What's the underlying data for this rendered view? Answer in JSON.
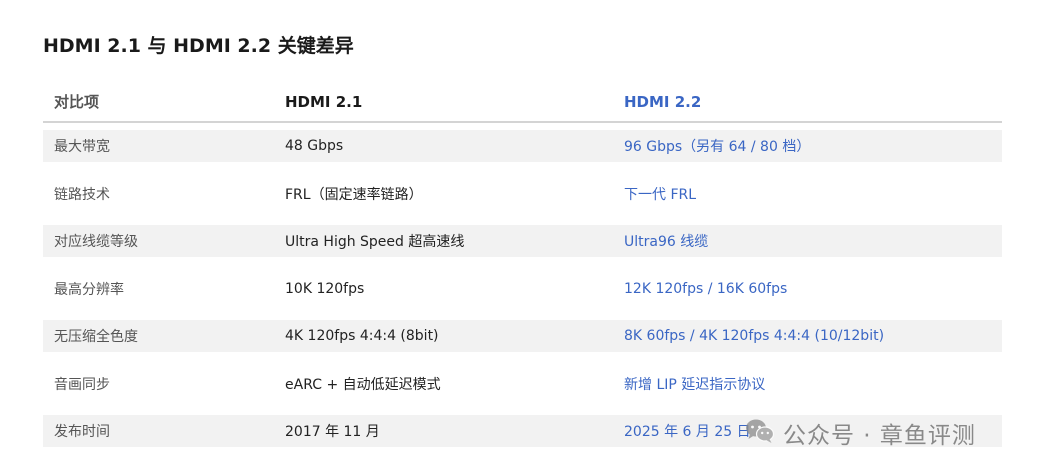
{
  "title": "HDMI 2.1 与 HDMI 2.2 关键差异",
  "table": {
    "headers": [
      "对比项",
      "HDMI 2.1",
      "HDMI 2.2"
    ],
    "rows": [
      [
        "最大带宽",
        "48 Gbps",
        "96 Gbps（另有 64 / 80 档）"
      ],
      [
        "链路技术",
        "FRL（固定速率链路）",
        "下一代 FRL"
      ],
      [
        "对应线缆等级",
        "Ultra High Speed 超高速线",
        "Ultra96 线缆"
      ],
      [
        "最高分辨率",
        "10K 120fps",
        "12K 120fps / 16K 60fps"
      ],
      [
        "无压缩全色度",
        "4K 120fps 4:4:4 (8bit)",
        "8K 60fps / 4K 120fps 4:4:4 (10/12bit)"
      ],
      [
        "音画同步",
        "eARC + 自动低延迟模式",
        "新增 LIP 延迟指示协议"
      ],
      [
        "发布时间",
        "2017 年 11 月",
        "2025 年 6 月 25 日"
      ]
    ]
  },
  "watermark": {
    "text": "公众号 · 章鱼评测",
    "icon": "wechat-icon"
  },
  "colors": {
    "accent": "#3a66c4",
    "stripe": "#f2f2f2",
    "divider": "#d4d4d4"
  }
}
